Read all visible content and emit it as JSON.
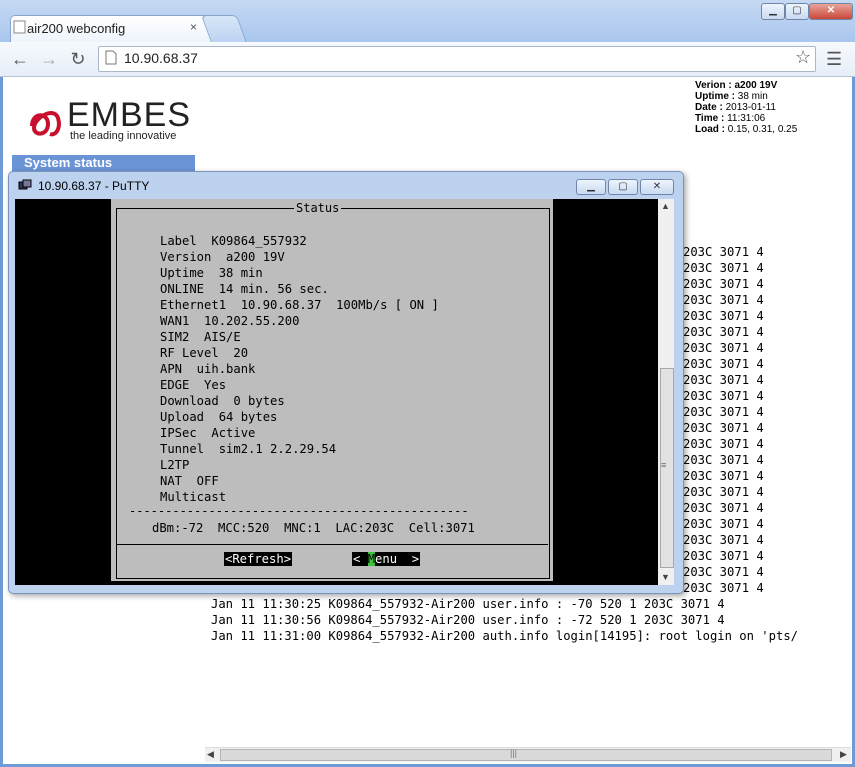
{
  "browser": {
    "tab_title": "air200 webconfig",
    "tab_close": "×",
    "url": "10.90.68.37",
    "win_min": "▁",
    "win_max": "▢",
    "win_close": "✕",
    "icons": {
      "back": "back-arrow-icon",
      "forward": "forward-arrow-icon",
      "reload": "reload-icon",
      "star": "star-icon",
      "menu": "menu-icon"
    }
  },
  "page": {
    "logo_text": "EMBES",
    "logo_tagline": "the leading innovative",
    "info": {
      "version_label": "Verion :",
      "version_value": "a200 19V",
      "uptime_label": "Uptime :",
      "uptime_value": "38 min",
      "date_label": "Date :",
      "date_value": "2013-01-11",
      "time_label": "Time :",
      "time_value": "11:31:06",
      "load_label": "Load :",
      "load_value": "0.15, 0.31, 0.25"
    },
    "nav_system_status": "System status",
    "log_lines": [
      "203C 3071 4",
      "203C 3071 4",
      "203C 3071 4",
      "203C 3071 4",
      "203C 3071 4",
      "203C 3071 4",
      "203C 3071 4",
      "203C 3071 4",
      "203C 3071 4",
      "203C 3071 4",
      "203C 3071 4",
      "203C 3071 4",
      "203C 3071 4",
      "203C 3071 4",
      "203C 3071 4",
      "203C 3071 4",
      "203C 3071 4",
      "203C 3071 4",
      "203C 3071 4",
      "203C 3071 4",
      "203C 3071 4",
      "203C 3071 4"
    ],
    "log_full_lines": [
      "Jan 11 11:30:25 K09864_557932-Air200 user.info : -70 520 1 203C 3071 4",
      "Jan 11 11:30:56 K09864_557932-Air200 user.info : -72 520 1 203C 3071 4",
      "Jan 11 11:31:00 K09864_557932-Air200 auth.info login[14195]: root login on 'pts/"
    ]
  },
  "putty": {
    "title": "10.90.68.37 - PuTTY",
    "dialog_title": "Status",
    "status_lines": [
      "Label  K09864_557932",
      "Version  a200 19V",
      "Uptime  38 min",
      "ONLINE  14 min. 56 sec.",
      "Ethernet1  10.90.68.37  100Mb/s [ ON ]",
      "WAN1  10.202.55.200",
      "SIM2  AIS/E",
      "RF Level  20",
      "APN  uih.bank",
      "EDGE  Yes",
      "Download  0 bytes",
      "Upload  64 bytes",
      "IPSec  Active",
      "Tunnel  sim2.1 2.2.29.54",
      "L2TP",
      "NAT  OFF",
      "Multicast"
    ],
    "divider": "-----------------------------------------------",
    "cell_info": "dBm:-72  MCC:520  MNC:1  LAC:203C  Cell:3071",
    "refresh_label": "<Refresh>",
    "menu_prefix": "< ",
    "menu_hotkey": "M",
    "menu_suffix": "enu  >"
  }
}
